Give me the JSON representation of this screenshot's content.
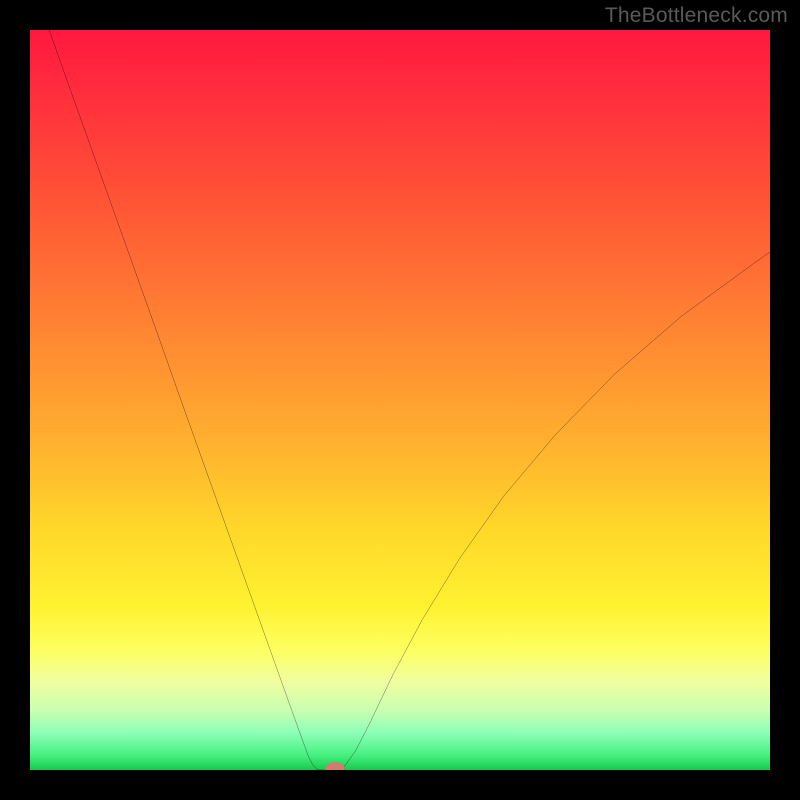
{
  "watermark": "TheBottleneck.com",
  "chart_data": {
    "type": "line",
    "title": "",
    "xlabel": "",
    "ylabel": "",
    "xlim": [
      0,
      100
    ],
    "ylim": [
      0,
      100
    ],
    "grid": false,
    "legend": false,
    "series": [
      {
        "name": "curve",
        "x": [
          2.6,
          5,
          8,
          11,
          14,
          17,
          20,
          23,
          26,
          29,
          32,
          34,
          35.5,
          36.8,
          37.6,
          38.2,
          38.7,
          39,
          39.2
        ],
        "y": [
          100,
          93.2,
          84.8,
          76.4,
          68,
          59.6,
          51.1,
          42.7,
          34.3,
          25.9,
          17.5,
          11.9,
          7.7,
          4.1,
          1.9,
          0.7,
          0.18,
          0.03,
          0
        ]
      },
      {
        "name": "curve-flat",
        "x": [
          39.2,
          40.2,
          41.0,
          41.6
        ],
        "y": [
          0,
          0,
          0,
          0.03
        ]
      },
      {
        "name": "curve-right",
        "x": [
          41.6,
          42.5,
          44,
          46,
          49,
          53,
          58,
          64,
          71,
          79,
          88,
          98,
          100
        ],
        "y": [
          0.03,
          0.5,
          2.6,
          6.5,
          12.8,
          20.3,
          28.5,
          37,
          45.3,
          53.5,
          61.3,
          68.6,
          70
        ]
      }
    ],
    "marker": {
      "x": 41.2,
      "y": 0.2,
      "color": "#d57a6f",
      "rx": 1.3,
      "ry": 0.9
    },
    "gradient_stops": [
      {
        "pos": 0,
        "color": "#ff183f"
      },
      {
        "pos": 8,
        "color": "#ff2c3d"
      },
      {
        "pos": 22,
        "color": "#ff5136"
      },
      {
        "pos": 38,
        "color": "#ff7e33"
      },
      {
        "pos": 55,
        "color": "#ffae2f"
      },
      {
        "pos": 68,
        "color": "#ffd92a"
      },
      {
        "pos": 78,
        "color": "#fff231"
      },
      {
        "pos": 84,
        "color": "#fdff63"
      },
      {
        "pos": 88,
        "color": "#f0ffa0"
      },
      {
        "pos": 92,
        "color": "#c8ffb2"
      },
      {
        "pos": 95,
        "color": "#8cffb8"
      },
      {
        "pos": 98,
        "color": "#46f07f"
      },
      {
        "pos": 100,
        "color": "#18c94e"
      }
    ]
  }
}
